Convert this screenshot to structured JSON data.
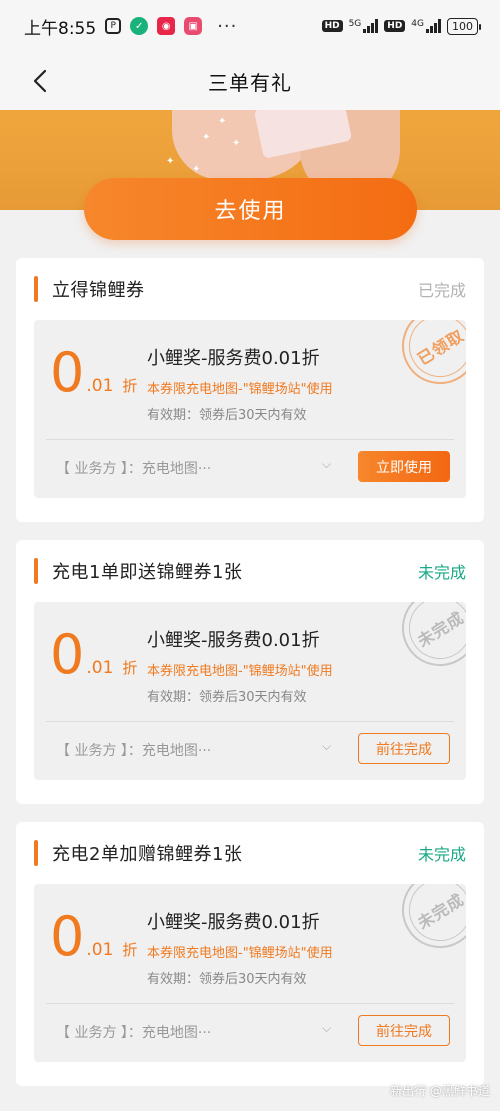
{
  "status_bar": {
    "time": "上午8:55",
    "icons": [
      "p-icon",
      "shield-app-icon",
      "weibo-icon",
      "app-icon"
    ],
    "more": "···",
    "hd1": "HD",
    "net1": "5G",
    "hd2": "HD",
    "net2": "4G",
    "battery": "100"
  },
  "nav": {
    "back_icon": "chevron-left-icon",
    "title": "三单有礼"
  },
  "banner": {
    "use_button_label": "去使用"
  },
  "colors": {
    "accent": "#f07a20",
    "done_status": "#b3b3b3",
    "pending_status": "#1aa886"
  },
  "tasks": [
    {
      "title": "立得锦鲤券",
      "status": "已完成",
      "status_color": "#b3b3b3",
      "coupon": {
        "discount_big": "0",
        "discount_small": ".01",
        "discount_unit": "折",
        "name": "小鲤奖-服务费0.01折",
        "note": "本券限充电地图-\"锦鲤场站\"使用",
        "validity": "有效期：领券后30天内有效",
        "provider": "【 业务方 】：充电地图···",
        "stamp": "已领取",
        "action": "立即使用"
      }
    },
    {
      "title": "充电1单即送锦鲤券1张",
      "status": "未完成",
      "status_color": "#1aa886",
      "coupon": {
        "discount_big": "0",
        "discount_small": ".01",
        "discount_unit": "折",
        "name": "小鲤奖-服务费0.01折",
        "note": "本券限充电地图-\"锦鲤场站\"使用",
        "validity": "有效期：领券后30天内有效",
        "provider": "【 业务方 】：充电地图···",
        "stamp": "未完成",
        "action": "前往完成"
      }
    },
    {
      "title": "充电2单加赠锦鲤券1张",
      "status": "未完成",
      "status_color": "#1aa886",
      "coupon": {
        "discount_big": "0",
        "discount_small": ".01",
        "discount_unit": "折",
        "name": "小鲤奖-服务费0.01折",
        "note": "本券限充电地图-\"锦鲤场站\"使用",
        "validity": "有效期：领券后30天内有效",
        "provider": "【 业务方 】：充电地图···",
        "stamp": "未完成",
        "action": "前往完成"
      }
    }
  ],
  "watermark": "新出行 @黑鲜书道"
}
